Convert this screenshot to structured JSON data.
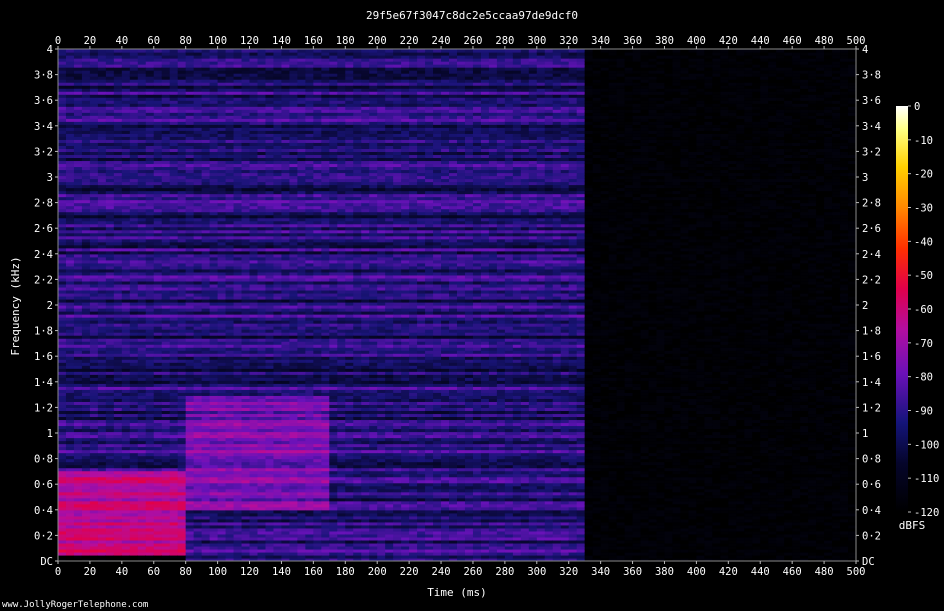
{
  "chart_data": {
    "type": "heatmap",
    "title": "29f5e67f3047c8dc2e5ccaa97de9dcf0",
    "xlabel": "Time (ms)",
    "ylabel": "Frequency (kHz)",
    "xlim": [
      0,
      500
    ],
    "ylim": [
      0,
      4
    ],
    "x_ticks": [
      "0",
      "20",
      "40",
      "60",
      "80",
      "100",
      "120",
      "140",
      "160",
      "180",
      "200",
      "220",
      "240",
      "260",
      "280",
      "300",
      "320",
      "340",
      "360",
      "380",
      "400",
      "420",
      "440",
      "460",
      "480",
      "500"
    ],
    "y_ticks": [
      "DC",
      "0·2",
      "0·4",
      "0·6",
      "0·8",
      "1",
      "1·2",
      "1·4",
      "1·6",
      "1·8",
      "2",
      "2·2",
      "2·4",
      "2·6",
      "2·8",
      "3",
      "3·2",
      "3·4",
      "3·6",
      "3·8",
      "4"
    ],
    "colorbar": {
      "label": "dBFS",
      "range": [
        -120,
        0
      ],
      "ticks": [
        "0",
        "-10",
        "-20",
        "-30",
        "-40",
        "-50",
        "-60",
        "-70",
        "-80",
        "-90",
        "-100",
        "-110",
        "-120"
      ]
    },
    "regions": [
      {
        "t_start": 0,
        "t_end": 80,
        "f_start": 0.05,
        "f_end": 0.7,
        "level_dbfs": -70
      },
      {
        "t_start": 0,
        "t_end": 80,
        "f_start": 0.7,
        "f_end": 4,
        "level_dbfs": -95
      },
      {
        "t_start": 80,
        "t_end": 170,
        "f_start": 0.4,
        "f_end": 1.3,
        "level_dbfs": -82
      },
      {
        "t_start": 80,
        "t_end": 330,
        "f_start": 0,
        "f_end": 4,
        "level_dbfs": -95
      },
      {
        "t_start": 330,
        "t_end": 500,
        "f_start": 0,
        "f_end": 4,
        "level_dbfs": -118
      }
    ]
  },
  "footer": {
    "credit": "www.JollyRogerTelephone.com"
  }
}
